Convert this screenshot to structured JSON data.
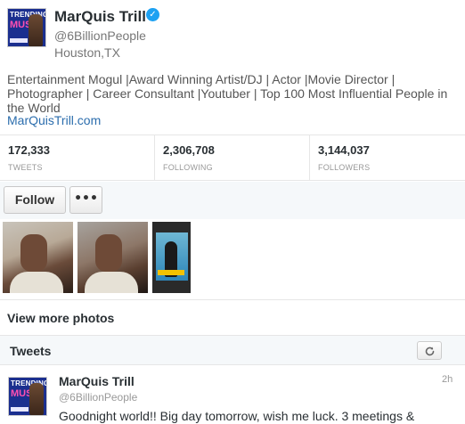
{
  "profile": {
    "avatar_text_top": "TRENDING",
    "avatar_text_main": "MUSIC",
    "name": "MarQuis Trill",
    "verified_icon": "verified-check-icon",
    "handle": "@6BillionPeople",
    "location": "Houston,TX",
    "bio": "Entertainment Mogul |Award Winning Artist/DJ | Actor |Movie Director | Photographer | Career Consultant |Youtuber | Top 100 Most Influential People in the World",
    "url": "MarQuisTrill.com"
  },
  "stats": [
    {
      "value": "172,333",
      "label": "TWEETS"
    },
    {
      "value": "2,306,708",
      "label": "FOLLOWING"
    },
    {
      "value": "3,144,037",
      "label": "FOLLOWERS"
    }
  ],
  "actions": {
    "follow_label": "Follow",
    "more_label": "•••"
  },
  "photos": {
    "view_more_label": "View more photos"
  },
  "tweets": {
    "header": "Tweets",
    "refresh_icon": "refresh-icon",
    "items": [
      {
        "name": "MarQuis Trill",
        "handle": "@6BillionPeople",
        "time": "2h",
        "text": "Goodnight world!! Big day tomorrow, wish me luck. 3 meetings &"
      }
    ]
  },
  "colors": {
    "link": "#2b6dad",
    "verified": "#1da1f2",
    "panel_bg": "#f5f8fa"
  }
}
